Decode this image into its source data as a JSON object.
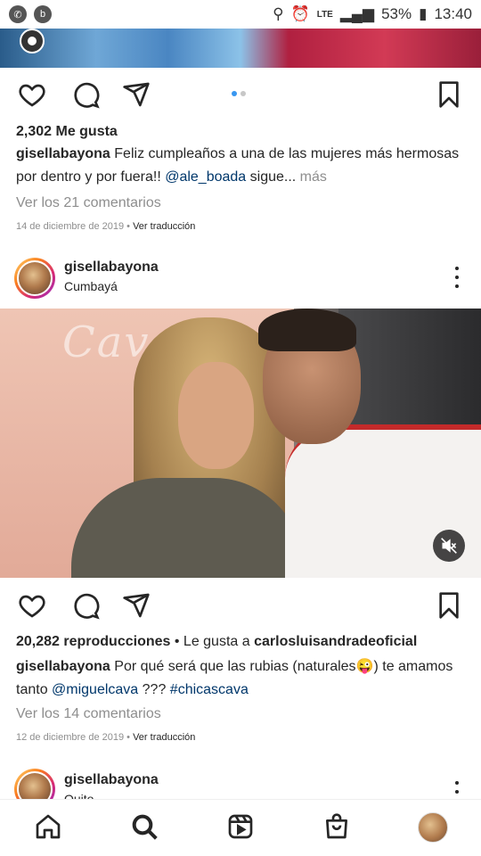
{
  "status_bar": {
    "time": "13:40",
    "battery": "53%",
    "network": "LTE",
    "icons": [
      "whatsapp-icon",
      "app-icon",
      "location-icon",
      "alarm-icon",
      "signal-icon",
      "battery-icon"
    ]
  },
  "post1": {
    "likes": "2,302 Me gusta",
    "caption_user": "gisellabayona",
    "caption_text": "Feliz cumpleaños a una de las mujeres más hermosas por dentro y por fuera!! ",
    "caption_mention": "@ale_boada",
    "caption_tail": " sigue... ",
    "more": "más",
    "view_comments": "Ver los 21 comentarios",
    "date": "14 de diciembre de 2019",
    "translate": "Ver traducción"
  },
  "post2": {
    "username": "gisellabayona",
    "location": "Cumbayá",
    "video_sign": "Cava",
    "views": "20,282 reproducciones",
    "liked_by_prefix": " • Le gusta a ",
    "liked_by_user": "carlosluisandradeoficial",
    "caption_user": "gisellabayona",
    "caption_text": "Por qué será que las rubias (naturales😜) te amamos tanto ",
    "caption_mention": "@miguelcava",
    "caption_mid": " ??? ",
    "caption_hashtag": "#chicascava",
    "view_comments": "Ver los 14 comentarios",
    "date": "12 de diciembre de 2019",
    "translate": "Ver traducción"
  },
  "post3": {
    "username": "gisellabayona",
    "location": "Quito"
  },
  "colors": {
    "link": "#00376b",
    "muted": "#8e8e8e",
    "carousel_active": "#3897f0"
  }
}
